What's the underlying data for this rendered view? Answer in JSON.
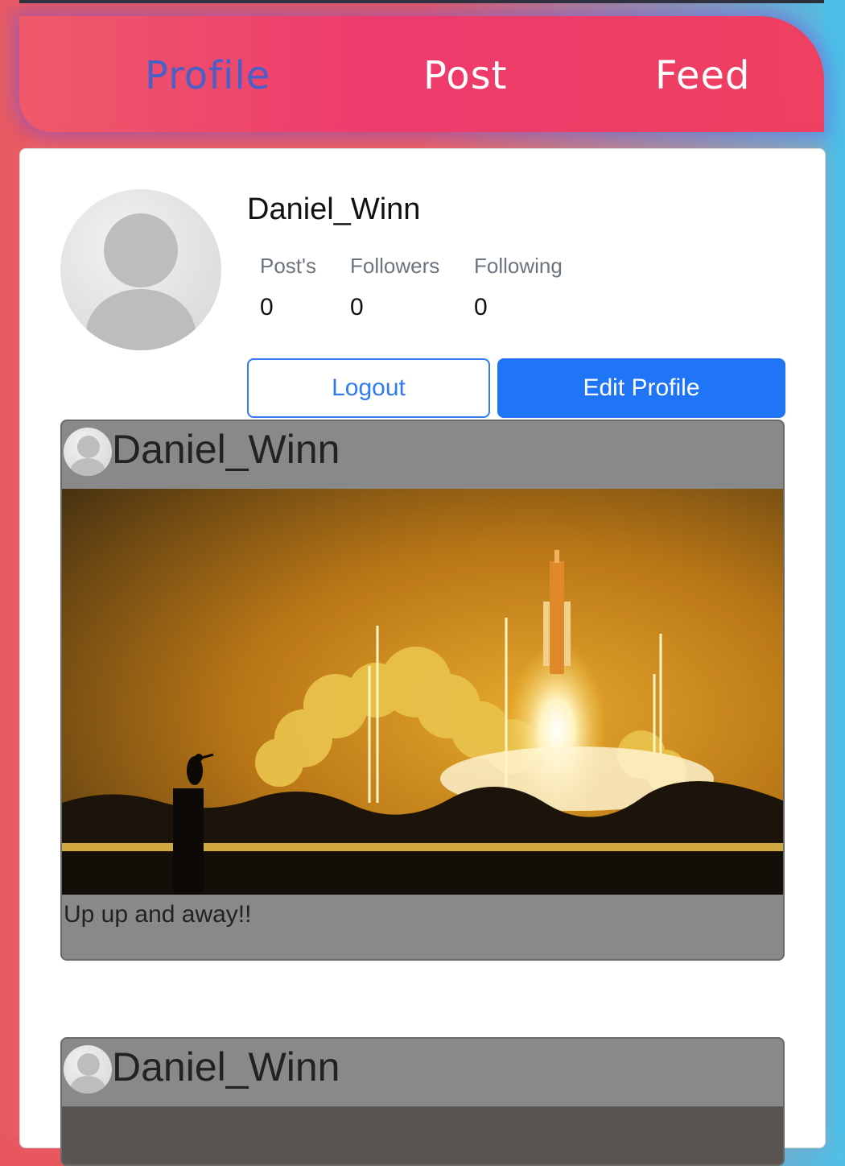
{
  "nav": {
    "profile": "Profile",
    "post": "Post",
    "feed": "Feed"
  },
  "profile": {
    "username": "Daniel_Winn",
    "stats": {
      "posts_label": "Post's",
      "posts_value": "0",
      "followers_label": "Followers",
      "followers_value": "0",
      "following_label": "Following",
      "following_value": "0"
    },
    "logout_label": "Logout",
    "edit_label": "Edit Profile"
  },
  "posts": [
    {
      "username": "Daniel_Winn",
      "caption": "Up up and away!!"
    },
    {
      "username": "Daniel_Winn"
    }
  ],
  "colors": {
    "accent": "#1f75f5",
    "nav_active": "#4b5fc9",
    "nav_bg": "#ee3a6d"
  }
}
